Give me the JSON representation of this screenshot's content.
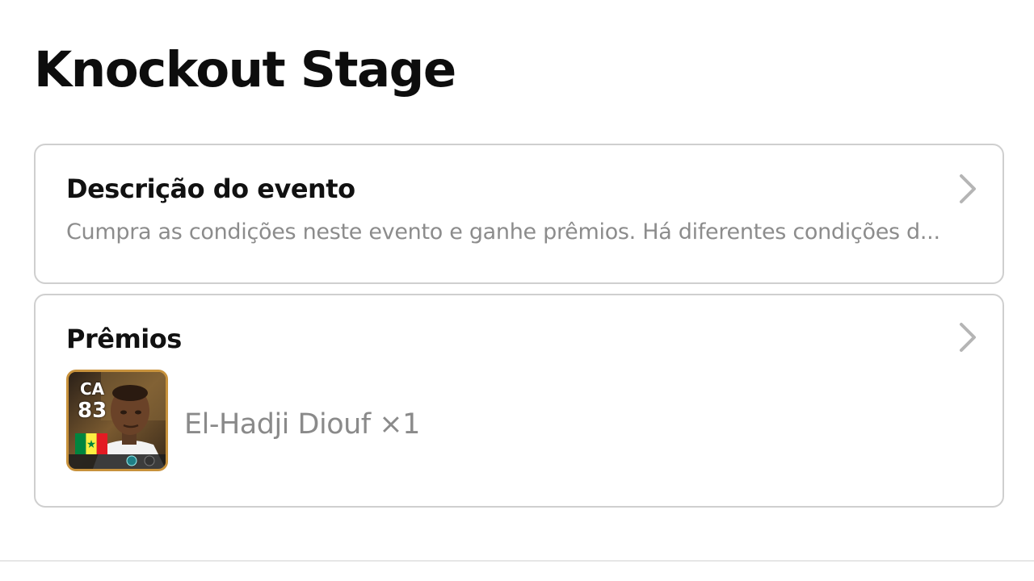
{
  "page": {
    "title": "Knockout Stage"
  },
  "event_description": {
    "heading": "Descrição do evento",
    "text": "Cumpra as condições neste evento e ganhe prêmios. Há diferentes condições d..."
  },
  "prizes": {
    "heading": "Prêmios",
    "items": [
      {
        "player_position": "CA",
        "player_rating": "83",
        "label": "El-Hadji Diouf ×1",
        "flag": "senegal-flag-icon"
      }
    ]
  },
  "colors": {
    "card_border": "#cfcfcf",
    "secondary_text": "#8c8c8c",
    "chevron": "#b5b5b5",
    "card_frame_gold": "#c8923c",
    "senegal_green": "#00853f",
    "senegal_yellow": "#fdef42",
    "senegal_red": "#e31b23"
  }
}
